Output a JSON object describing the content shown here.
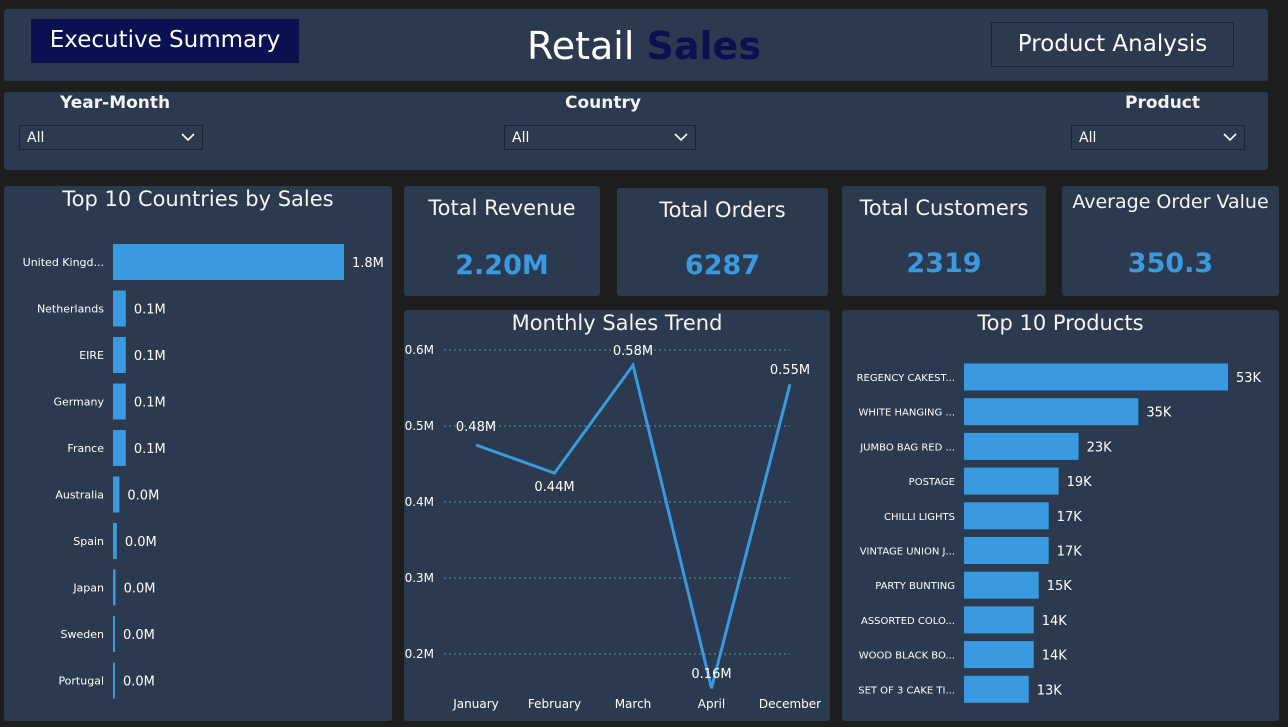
{
  "header": {
    "exec_button": "Executive Summary",
    "title_part1": "Retail",
    "title_part2": "Sales",
    "product_button": "Product Analysis"
  },
  "filters": [
    {
      "label": "Year-Month",
      "value": "All"
    },
    {
      "label": "Country",
      "value": "All"
    },
    {
      "label": "Product",
      "value": "All"
    }
  ],
  "kpis": [
    {
      "label": "Total Revenue",
      "value": "2.20M"
    },
    {
      "label": "Total Orders",
      "value": "6287"
    },
    {
      "label": "Total Customers",
      "value": "2319"
    },
    {
      "label": "Average Order Value",
      "value": "350.3"
    }
  ],
  "colors": {
    "bar": "#3a9ae0",
    "panel": "#2b3a4e",
    "background": "#1e1e1e",
    "title_accent": "#0a1150"
  },
  "chart_data": [
    {
      "type": "bar",
      "orientation": "horizontal",
      "title": "Top 10 Countries by Sales",
      "categories": [
        "United Kingd...",
        "Netherlands",
        "EIRE",
        "Germany",
        "France",
        "Australia",
        "Spain",
        "Japan",
        "Sweden",
        "Portugal"
      ],
      "values": [
        1.8,
        0.1,
        0.1,
        0.1,
        0.1,
        0.05,
        0.03,
        0.02,
        0.01,
        0.01
      ],
      "data_labels": [
        "1.8M",
        "0.1M",
        "0.1M",
        "0.1M",
        "0.1M",
        "0.0M",
        "0.0M",
        "0.0M",
        "0.0M",
        "0.0M"
      ],
      "units": "M",
      "xlim": [
        0,
        1.8
      ]
    },
    {
      "type": "line",
      "title": "Monthly Sales Trend",
      "categories": [
        "January",
        "February",
        "March",
        "April",
        "December"
      ],
      "values": [
        0.475,
        0.438,
        0.58,
        0.155,
        0.555
      ],
      "data_labels": [
        "0.48M",
        "0.44M",
        "0.58M",
        "0.16M",
        "0.55M"
      ],
      "yticks": [
        "0.2M",
        "0.3M",
        "0.4M",
        "0.5M",
        "0.6M"
      ],
      "ytick_values": [
        0.2,
        0.3,
        0.4,
        0.5,
        0.6
      ],
      "ylim": [
        0.15,
        0.6
      ],
      "grid": true
    },
    {
      "type": "bar",
      "orientation": "horizontal",
      "title": "Top 10 Products",
      "categories": [
        "REGENCY CAKEST...",
        "WHITE HANGING ...",
        "JUMBO BAG RED ...",
        "POSTAGE",
        "CHILLI LIGHTS",
        "VINTAGE UNION J...",
        "PARTY BUNTING",
        "ASSORTED COLO...",
        "WOOD BLACK BO...",
        "SET OF 3 CAKE TI..."
      ],
      "values": [
        53,
        35,
        23,
        19,
        17,
        17,
        15,
        14,
        14,
        13
      ],
      "data_labels": [
        "53K",
        "35K",
        "23K",
        "19K",
        "17K",
        "17K",
        "15K",
        "14K",
        "14K",
        "13K"
      ],
      "units": "K",
      "xlim": [
        0,
        53
      ]
    }
  ]
}
